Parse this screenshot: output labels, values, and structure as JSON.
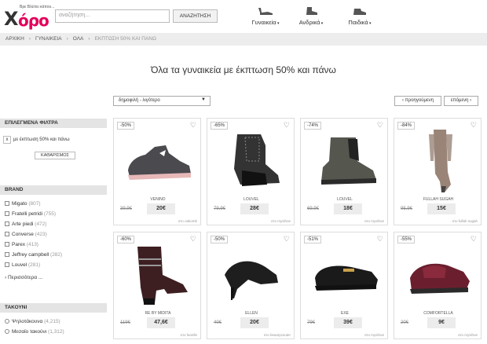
{
  "logo": {
    "tagline": "Βρε Βλέπει κάπου...",
    "word": "όρο",
    "mark": "X"
  },
  "search": {
    "placeholder": "αναζήτηση...",
    "button": "ΑΝΑΖΗΤΗΣΗ"
  },
  "categories": [
    {
      "label": "Γυναικεία",
      "icon": "women-shoe-icon"
    },
    {
      "label": "Ανδρικά",
      "icon": "men-shoe-icon"
    },
    {
      "label": "Παιδικά",
      "icon": "kids-shoe-icon"
    }
  ],
  "breadcrumb": [
    "ΑΡΧΙΚΗ",
    "ΓΥΝΑΙΚΕΙΑ",
    "ΟΛΑ",
    "ΕΚΠΤΩΣΗ 50% ΚΑΙ ΠΑΝΩ"
  ],
  "page_title": "Όλα τα γυναικεία με έκπτωση 50% και πάνω",
  "sort": {
    "value": "δημοφιλή - λιγότερο"
  },
  "pager": {
    "prev": "‹ προηγούμενη",
    "next": "επόμενη ›"
  },
  "filters": {
    "selected_heading": "ΕΠΙΛΕΓΜΕΝΑ ΦΙΛΤΡΑ",
    "selected_chip": "με έκπτωση 50% και πάνω",
    "clear": "ΚΑΘΑΡΙΣΜΟΣ",
    "brand_heading": "BRAND",
    "brands": [
      {
        "name": "Migato",
        "count": "(807)"
      },
      {
        "name": "Fratelli petridi",
        "count": "(755)"
      },
      {
        "name": "Arte piedi",
        "count": "(472)"
      },
      {
        "name": "Converse",
        "count": "(423)"
      },
      {
        "name": "Parex",
        "count": "(413)"
      },
      {
        "name": "Jeffrey campbell",
        "count": "(282)"
      },
      {
        "name": "Louvel",
        "count": "(281)"
      }
    ],
    "more": "Περισσότερα ...",
    "heel_heading": "ΤΑΚΟΥΝΙ",
    "heels": [
      {
        "name": "Ψηλοτάκουνα",
        "count": "(4,215)"
      },
      {
        "name": "Μεσαίο τακούνι",
        "count": "(1,312)"
      }
    ]
  },
  "products": [
    {
      "discount": "-50%",
      "brand": "VENINO",
      "old": "39,9€",
      "new": "20€",
      "shop": "στο oakomb",
      "type": "sneaker",
      "color": "#4a4a4f"
    },
    {
      "discount": "-65%",
      "brand": "LOUVEL",
      "old": "79,9€",
      "new": "28€",
      "shop": "στο mysihoe",
      "type": "wedge-sneaker",
      "color": "#333333"
    },
    {
      "discount": "-74%",
      "brand": "LOUVEL",
      "old": "69,9€",
      "new": "18€",
      "shop": "στο mysihoe",
      "type": "ankle-boot",
      "color": "#55574f"
    },
    {
      "discount": "-84%",
      "brand": "FULLAH SUGAH",
      "old": "95,9€",
      "new": "15€",
      "shop": "στο fullah sugah",
      "type": "tall-boot",
      "color": "#9a8478"
    },
    {
      "discount": "-60%",
      "brand": "RE BY MIDITA",
      "old": "119€",
      "new": "47,6€",
      "shop": "στο fanelle",
      "type": "heeled-boot",
      "color": "#3d1f22"
    },
    {
      "discount": "-50%",
      "brand": "ELLEN",
      "old": "40€",
      "new": "20€",
      "shop": "στο beautysouter",
      "type": "pump",
      "color": "#1e1e1e"
    },
    {
      "discount": "-51%",
      "brand": "EXE",
      "old": "79€",
      "new": "39€",
      "shop": "στο mysihoe",
      "type": "loafer",
      "color": "#1a1a1a"
    },
    {
      "discount": "-55%",
      "brand": "COMFORTELLA",
      "old": "20€",
      "new": "9€",
      "shop": "στο mysihoe",
      "type": "slipper",
      "color": "#6b1f2e"
    }
  ]
}
